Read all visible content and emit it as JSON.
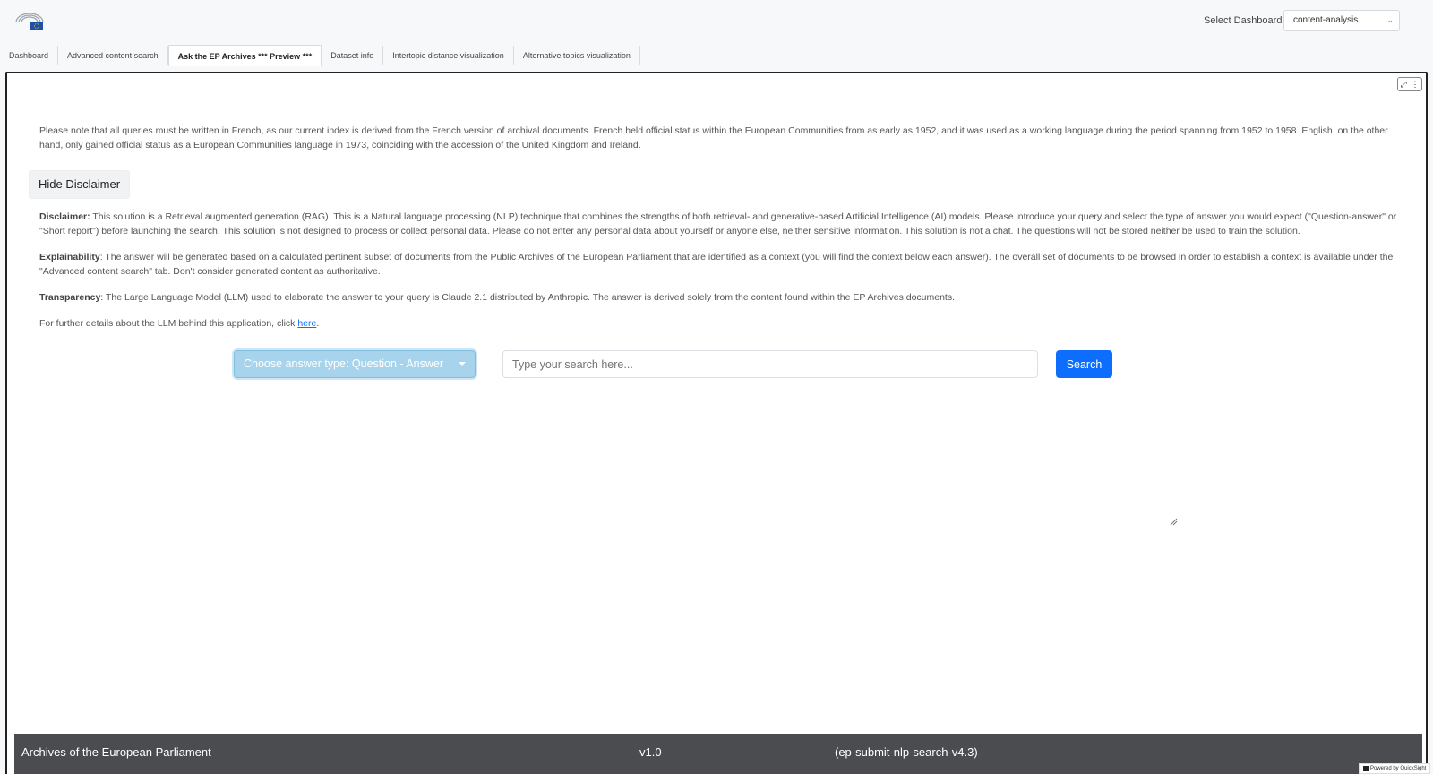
{
  "header": {
    "select_label": "Select Dashboard",
    "dashboard_value": "content-analysis"
  },
  "tabs": [
    {
      "label": "Dashboard",
      "active": false
    },
    {
      "label": "Advanced content search",
      "active": false
    },
    {
      "label": "Ask the EP Archives *** Preview ***",
      "active": true
    },
    {
      "label": "Dataset info",
      "active": false
    },
    {
      "label": "Intertopic distance visualization",
      "active": false
    },
    {
      "label": "Alternative topics visualization",
      "active": false
    }
  ],
  "content": {
    "note": "Please note that all queries must be written in French, as our current index is derived from the French version of archival documents. French held official status within the European Communities from as early as 1952, and it was used as a working language during the period spanning from 1952 to 1958. English, on the other hand, only gained official status as a European Communities language in 1973, coinciding with the accession of the United Kingdom and Ireland.",
    "hide_disclaimer_label": "Hide Disclaimer",
    "disclaimer_title": "Disclaimer:",
    "disclaimer_text": " This solution is a Retrieval augmented generation (RAG). This is a Natural language processing (NLP) technique that combines the strengths of both retrieval- and generative-based Artificial Intelligence (AI) models. Please introduce your query and select the type of answer you would expect (\"Question-answer\" or \"Short report\") before launching the search. This solution is not designed to process or collect personal data. Please do not enter any personal data about yourself or anyone else, neither sensitive information. This solution is not a chat. The questions will not be stored neither be used to train the solution.",
    "explainability_title": "Explainability",
    "explainability_text": ": The answer will be generated based on a calculated pertinent subset of documents from the Public Archives of the European Parliament that are identified as a context (you will find the context below each answer). The overall set of documents to be browsed in order to establish a context is available under the \"Advanced content search\" tab. Don't consider generated content as authoritative.",
    "transparency_title": "Transparency",
    "transparency_text": ": The Large Language Model (LLM) used to elaborate the answer to your query is Claude 2.1 distributed by Anthropic. The answer is derived solely from the content found within the EP Archives documents.",
    "further_text": "For further details about the LLM behind this application, click ",
    "further_link": "here",
    "further_end": "."
  },
  "query": {
    "answer_type_label": "Choose answer type: Question - Answer",
    "search_placeholder": "Type your search here...",
    "search_button": "Search"
  },
  "footer": {
    "title": "Archives of the European Parliament",
    "version": "v1.0",
    "build": "(ep-submit-nlp-search-v4.3)",
    "powered": "Powered by QuickSight"
  },
  "colors": {
    "accent": "#0d6efd",
    "answer_type_bg": "#a7d4ec",
    "footer_bg": "#4a4c50"
  }
}
